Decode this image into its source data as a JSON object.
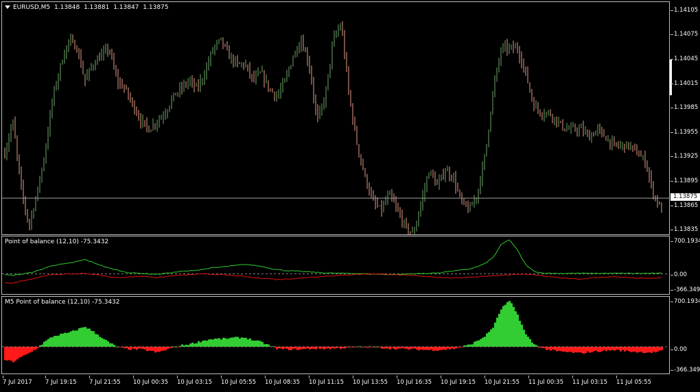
{
  "main_chart": {
    "symbol_header": "EURUSD,M5",
    "ohlc": [
      "1.13848",
      "1.13881",
      "1.13847",
      "1.13875"
    ],
    "price_ticks": [
      "1.14105",
      "1.14075",
      "1.14045",
      "1.14015",
      "1.13985",
      "1.13955",
      "1.13925",
      "1.13895",
      "1.13865",
      "1.13835"
    ],
    "current_price": "1.13875",
    "colors": {
      "up_bar": "#6fa86a",
      "down_bar": "#e8a08a",
      "price_line": "#a0a0a0"
    }
  },
  "indicator_1": {
    "title": "Point of balance (12,10) -75.3432",
    "ticks": [
      "700.1934",
      "0.00",
      "-366.3499"
    ],
    "colors": {
      "line_green": "#2ecc2e",
      "line_red": "#e01010",
      "zero_line": "#808080"
    }
  },
  "indicator_2": {
    "title": "M5 Point of balance (12,10) -75.3432",
    "ticks": [
      "700.1934",
      "0.00",
      "-366.3499"
    ],
    "colors": {
      "hist_pos": "#32cd32",
      "hist_neg": "#ff1a1a"
    }
  },
  "time_axis": {
    "labels": [
      "7 Jul 2017",
      "7 Jul 19:15",
      "7 Jul 21:55",
      "10 Jul 00:35",
      "10 Jul 03:15",
      "10 Jul 05:55",
      "10 Jul 08:35",
      "10 Jul 11:15",
      "10 Jul 13:55",
      "10 Jul 16:35",
      "10 Jul 19:15",
      "10 Jul 21:55",
      "11 Jul 00:35",
      "11 Jul 03:15",
      "11 Jul 05:55"
    ]
  },
  "chart_data": [
    {
      "type": "line",
      "name": "EURUSD,M5 close (approx. path)",
      "ylim": [
        1.13835,
        1.14115
      ],
      "y": [
        1.1393,
        1.1397,
        1.1389,
        1.1384,
        1.1388,
        1.1393,
        1.14,
        1.1404,
        1.1407,
        1.1406,
        1.1402,
        1.1404,
        1.1405,
        1.1406,
        1.1402,
        1.1401,
        1.1399,
        1.1397,
        1.1396,
        1.1397,
        1.1398,
        1.14,
        1.1401,
        1.1402,
        1.1401,
        1.1403,
        1.1406,
        1.1407,
        1.1405,
        1.1404,
        1.1404,
        1.1402,
        1.1403,
        1.1401,
        1.14,
        1.1402,
        1.1405,
        1.1407,
        1.1404,
        1.1397,
        1.14,
        1.1407,
        1.1409,
        1.14,
        1.1394,
        1.139,
        1.1387,
        1.1386,
        1.1388,
        1.1386,
        1.1384,
        1.1383,
        1.1387,
        1.1391,
        1.1389,
        1.1391,
        1.139,
        1.1387,
        1.1386,
        1.1388,
        1.1393,
        1.1401,
        1.1406,
        1.1406,
        1.1406,
        1.1403,
        1.1399,
        1.1398,
        1.1398,
        1.1397,
        1.1396,
        1.1396,
        1.1396,
        1.1395,
        1.1396,
        1.1395,
        1.1394,
        1.1394,
        1.1394,
        1.1393,
        1.1392,
        1.1388,
        1.1386
      ]
    },
    {
      "type": "line",
      "name": "Point of balance (12,10)",
      "ylim": [
        -366.3499,
        700.1934
      ],
      "series": [
        {
          "name": "green",
          "values": [
            -20,
            -30,
            -10,
            20,
            60,
            120,
            180,
            200,
            220,
            260,
            300,
            240,
            180,
            120,
            80,
            40,
            20,
            10,
            0,
            -10,
            10,
            30,
            50,
            60,
            80,
            100,
            130,
            140,
            160,
            180,
            200,
            180,
            160,
            120,
            90,
            70,
            60,
            50,
            40,
            30,
            20,
            15,
            10,
            10,
            5,
            0,
            -5,
            -10,
            -15,
            -10,
            -5,
            0,
            5,
            10,
            20,
            40,
            60,
            80,
            100,
            150,
            220,
            350,
            620,
            720,
            500,
            200,
            60,
            20,
            10,
            10,
            10,
            10,
            10,
            10,
            10,
            10,
            10,
            10,
            10,
            10,
            10,
            10,
            10
          ]
        },
        {
          "name": "red",
          "values": [
            -180,
            -200,
            -150,
            -120,
            -80,
            -40,
            -20,
            -10,
            -5,
            0,
            10,
            -10,
            -30,
            -60,
            -80,
            -70,
            -60,
            -50,
            -60,
            -80,
            -60,
            -40,
            -30,
            -20,
            -10,
            0,
            -10,
            -20,
            -30,
            -40,
            -60,
            -80,
            -90,
            -100,
            -120,
            -110,
            -100,
            -90,
            -70,
            -60,
            -50,
            -40,
            -30,
            -20,
            -10,
            -5,
            0,
            -5,
            -10,
            -20,
            -30,
            -40,
            -50,
            -60,
            -70,
            -80,
            -90,
            -80,
            -70,
            -60,
            -50,
            -40,
            -30,
            -20,
            -10,
            -10,
            -20,
            -40,
            -60,
            -80,
            -90,
            -100,
            -110,
            -90,
            -80,
            -70,
            -60,
            -70,
            -80,
            -90,
            -95,
            -95,
            -75
          ]
        }
      ]
    }
  ]
}
